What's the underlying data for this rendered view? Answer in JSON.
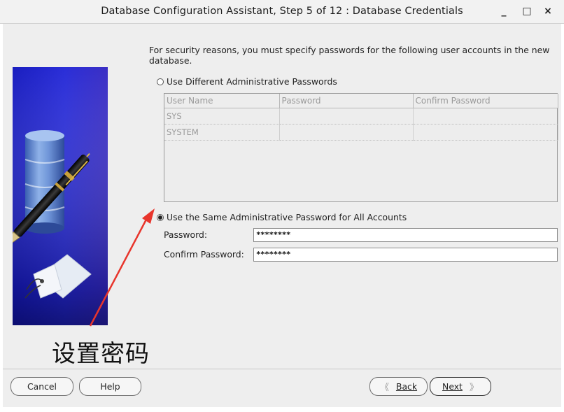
{
  "window": {
    "title": "Database Configuration Assistant, Step 5 of 12 : Database Credentials",
    "minimize_glyph": "_",
    "maximize_glyph": "□",
    "close_glyph": "×"
  },
  "description": "For security reasons, you must specify passwords for the following user accounts in the new database.",
  "options": {
    "different_label": "Use Different Administrative Passwords",
    "same_label": "Use the Same Administrative Password for All Accounts",
    "selected": "same"
  },
  "table": {
    "columns": [
      "User Name",
      "Password",
      "Confirm Password"
    ],
    "rows": [
      [
        "SYS",
        "",
        ""
      ],
      [
        "SYSTEM",
        "",
        ""
      ]
    ]
  },
  "same_password": {
    "password_label": "Password:",
    "password_value": "********",
    "confirm_label": "Confirm Password:",
    "confirm_value": "********"
  },
  "annotation_text": "设置密码",
  "buttons": {
    "cancel": "Cancel",
    "help": "Help",
    "back_chevron": "《",
    "back": "Back",
    "next": "Next",
    "next_chevron": "》"
  },
  "colors": {
    "graphic_blue": "#1a1ec0",
    "arrow_red": "#e8352c"
  },
  "icons": {
    "graphic": "database-pen-illustration",
    "arrow": "red-annotation-arrow"
  }
}
